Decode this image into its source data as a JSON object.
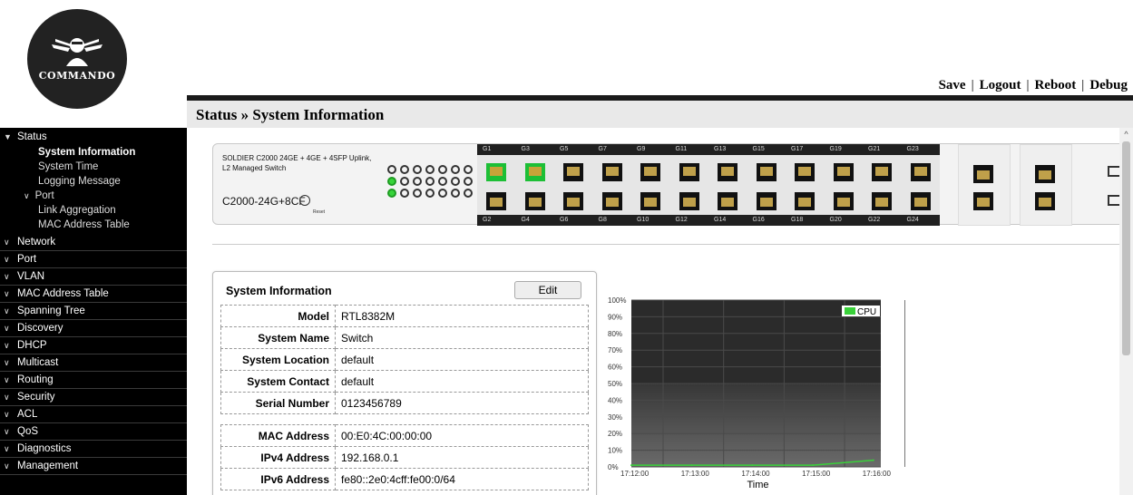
{
  "logo": {
    "brand": "COMMANDO"
  },
  "toplinks": {
    "save": "Save",
    "logout": "Logout",
    "reboot": "Reboot",
    "debug": "Debug",
    "sep": "|"
  },
  "header": {
    "title": "Status » System Information"
  },
  "sidebar": {
    "status": {
      "label": "Status",
      "items": [
        {
          "label": "System Information"
        },
        {
          "label": "System Time"
        },
        {
          "label": "Logging Message"
        }
      ],
      "port_group": "Port",
      "port_items": [
        {
          "label": "Link Aggregation"
        },
        {
          "label": "MAC Address Table"
        }
      ]
    },
    "groups": [
      {
        "label": "Network"
      },
      {
        "label": "Port"
      },
      {
        "label": "VLAN"
      },
      {
        "label": "MAC Address Table"
      },
      {
        "label": "Spanning Tree"
      },
      {
        "label": "Discovery"
      },
      {
        "label": "DHCP"
      },
      {
        "label": "Multicast"
      },
      {
        "label": "Routing"
      },
      {
        "label": "Security"
      },
      {
        "label": "ACL"
      },
      {
        "label": "QoS"
      },
      {
        "label": "Diagnostics"
      },
      {
        "label": "Management"
      }
    ]
  },
  "panel": {
    "desc_line1": "SOLDIER C2000 24GE + 4GE + 4SFP Uplink,",
    "desc_line2": "L2 Managed Switch",
    "model": "C2000-24G+8CF",
    "reset": "Reset",
    "top_ports": [
      "G1",
      "G3",
      "G5",
      "G7",
      "G9",
      "G11",
      "G13",
      "G15",
      "G17",
      "G19",
      "G21",
      "G23"
    ],
    "bottom_ports": [
      "G2",
      "G4",
      "G6",
      "G8",
      "G10",
      "G12",
      "G14",
      "G16",
      "G18",
      "G20",
      "G22",
      "G24"
    ],
    "active_ports": [
      "G1",
      "G3"
    ]
  },
  "sysinfo": {
    "title": "System Information",
    "edit": "Edit",
    "rows1": [
      {
        "k": "Model",
        "v": "RTL8382M"
      },
      {
        "k": "System Name",
        "v": "Switch"
      },
      {
        "k": "System Location",
        "v": "default"
      },
      {
        "k": "System Contact",
        "v": "default"
      },
      {
        "k": "Serial Number",
        "v": "0123456789"
      }
    ],
    "rows2": [
      {
        "k": "MAC Address",
        "v": "00:E0:4C:00:00:00"
      },
      {
        "k": "IPv4 Address",
        "v": "192.168.0.1"
      },
      {
        "k": "IPv6 Address",
        "v": "fe80::2e0:4cff:fe00:0/64"
      }
    ]
  },
  "colors": {
    "cpu_line": "#3ad13a",
    "sidebar_bg": "#000000",
    "header_bar": "#1a1a1a"
  },
  "chart_data": {
    "type": "line",
    "title": "",
    "xlabel": "Time",
    "ylabel": "",
    "x": [
      "17:12:00",
      "17:13:00",
      "17:14:00",
      "17:15:00",
      "17:16:00"
    ],
    "ylim": [
      0,
      100
    ],
    "yticks": [
      "0%",
      "10%",
      "20%",
      "30%",
      "40%",
      "50%",
      "60%",
      "70%",
      "80%",
      "90%",
      "100%"
    ],
    "legend": "top-right",
    "series": [
      {
        "name": "CPU",
        "values": [
          1,
          1,
          1,
          1,
          4
        ]
      }
    ]
  }
}
